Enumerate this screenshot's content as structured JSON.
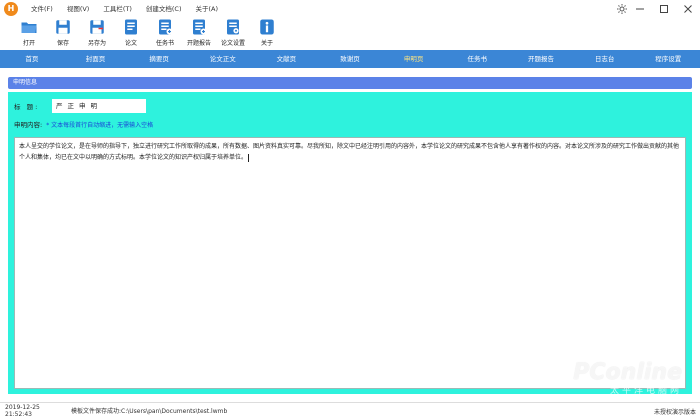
{
  "app": {
    "logo_text": "H"
  },
  "menu": {
    "items": [
      "文件(F)",
      "视图(V)",
      "工具栏(T)",
      "创建文档(C)",
      "关于(A)"
    ]
  },
  "toolbar": {
    "items": [
      {
        "label": "打开",
        "icon": "folder-open-icon",
        "color": "#2f7fd0"
      },
      {
        "label": "保存",
        "icon": "save-icon",
        "color": "#2f7fd0"
      },
      {
        "label": "另存为",
        "icon": "save-as-icon",
        "color": "#2f7fd0"
      },
      {
        "label": "论文",
        "icon": "paper-icon",
        "color": "#2f7fd0"
      },
      {
        "label": "任务书",
        "icon": "task-book-icon",
        "color": "#2f7fd0"
      },
      {
        "label": "开题报告",
        "icon": "proposal-icon",
        "color": "#2f7fd0"
      },
      {
        "label": "论文设置",
        "icon": "paper-settings-icon",
        "color": "#2f7fd0"
      },
      {
        "label": "关于",
        "icon": "info-icon",
        "color": "#2f7fd0"
      }
    ]
  },
  "nav": {
    "items": [
      "首页",
      "封面页",
      "摘要页",
      "论文正文",
      "文献页",
      "致谢页",
      "申明页",
      "任务书",
      "开题报告",
      "日志台",
      "程序设置"
    ],
    "active_index": 6
  },
  "section": {
    "title": "申明信息"
  },
  "form": {
    "title_label": "标    题:",
    "title_value": "严正申明",
    "content_label": "申明内容:",
    "content_hint": "* 文本每段首行自动缩进，无需输入空格",
    "content_text": "本人呈交的学位论文，是在导师的指导下，独立进行研究工作所取得的成果，所有数据、图片资料真实可靠。尽我所知，除文中已经注明引用的内容外，本学位论文的研究成果不包含他人享有著作权的内容。对本论文所涉及的研究工作做出贡献的其他个人和集体，均已在文中以明确的方式标明。本学位论文的知识产权归属于培养单位。"
  },
  "status": {
    "time": "2019-12-25 21:52:43",
    "message": "模板文件保存成功:C:\\Users\\pan\\Documents\\test.lwmb",
    "right": "未授权演示版本"
  },
  "watermark": {
    "main": "PConline",
    "sub": "太平洋电脑网"
  },
  "colors": {
    "nav_bg": "#3b86d6",
    "nav_active": "#ffe680",
    "section_bg": "#5b82e8",
    "form_bg": "#2ef2dd",
    "hint": "#1a46d8"
  }
}
